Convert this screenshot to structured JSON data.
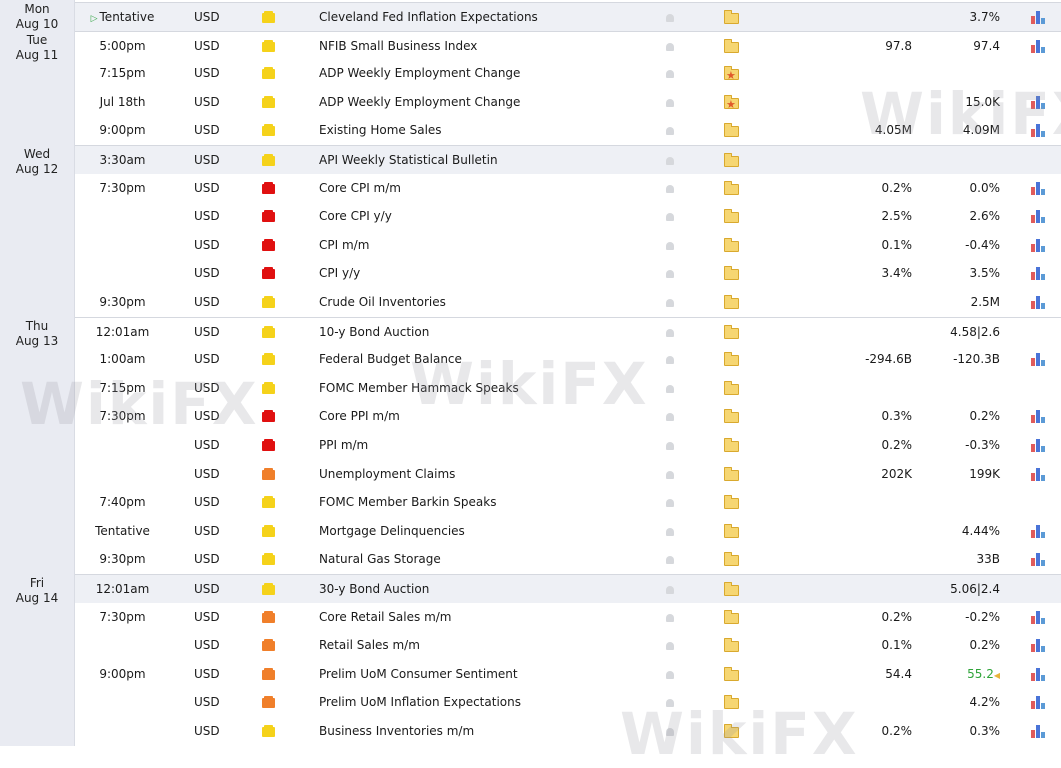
{
  "days": [
    {
      "weekday": "Mon",
      "date": "Aug 10"
    },
    {
      "weekday": "Tue",
      "date": "Aug 11"
    },
    {
      "weekday": "Wed",
      "date": "Aug 12"
    },
    {
      "weekday": "Thu",
      "date": "Aug 13"
    },
    {
      "weekday": "Fri",
      "date": "Aug 14"
    }
  ],
  "rows": [
    {
      "time": "Tentative",
      "tentative_marker": true,
      "currency": "USD",
      "importance": "low",
      "event": "Cleveland Fed Inflation Expectations",
      "actual": "",
      "forecast": "",
      "previous": "3.7%",
      "chart": true,
      "day_start": true,
      "folder": "plain"
    },
    {
      "time": "5:00pm",
      "currency": "USD",
      "importance": "low",
      "event": "NFIB Small Business Index",
      "actual": "97.8",
      "forecast": "",
      "previous": "97.4",
      "chart": true,
      "day_start": true,
      "folder": "plain"
    },
    {
      "time": "7:15pm",
      "currency": "USD",
      "importance": "low",
      "event": "ADP Weekly Employment Change",
      "actual": "",
      "forecast": "",
      "previous": "",
      "chart": false,
      "folder": "star"
    },
    {
      "time": "Jul 18th",
      "currency": "USD",
      "importance": "low",
      "event": "ADP Weekly Employment Change",
      "actual": "",
      "forecast": "",
      "previous": "15.0K",
      "chart": true,
      "folder": "star"
    },
    {
      "time": "9:00pm",
      "currency": "USD",
      "importance": "low",
      "event": "Existing Home Sales",
      "actual": "4.05M",
      "forecast": "",
      "previous": "4.09M",
      "chart": true,
      "folder": "plain"
    },
    {
      "time": "3:30am",
      "currency": "USD",
      "importance": "low",
      "event": "API Weekly Statistical Bulletin",
      "actual": "",
      "forecast": "",
      "previous": "",
      "chart": false,
      "day_start": true,
      "folder": "plain"
    },
    {
      "time": "7:30pm",
      "currency": "USD",
      "importance": "high",
      "event": "Core CPI m/m",
      "actual": "0.2%",
      "forecast": "",
      "previous": "0.0%",
      "chart": true,
      "folder": "plain"
    },
    {
      "time": "",
      "currency": "USD",
      "importance": "high",
      "event": "Core CPI y/y",
      "actual": "2.5%",
      "forecast": "",
      "previous": "2.6%",
      "chart": true,
      "folder": "plain"
    },
    {
      "time": "",
      "currency": "USD",
      "importance": "high",
      "event": "CPI m/m",
      "actual": "0.1%",
      "forecast": "",
      "previous": "-0.4%",
      "chart": true,
      "folder": "plain"
    },
    {
      "time": "",
      "currency": "USD",
      "importance": "high",
      "event": "CPI y/y",
      "actual": "3.4%",
      "forecast": "",
      "previous": "3.5%",
      "chart": true,
      "folder": "plain"
    },
    {
      "time": "9:30pm",
      "currency": "USD",
      "importance": "low",
      "event": "Crude Oil Inventories",
      "actual": "",
      "forecast": "",
      "previous": "2.5M",
      "chart": true,
      "folder": "plain"
    },
    {
      "time": "12:01am",
      "currency": "USD",
      "importance": "low",
      "event": "10-y Bond Auction",
      "actual": "",
      "forecast": "",
      "previous": "4.58|2.6",
      "chart": false,
      "day_start": true,
      "folder": "plain"
    },
    {
      "time": "1:00am",
      "currency": "USD",
      "importance": "low",
      "event": "Federal Budget Balance",
      "actual": "-294.6B",
      "forecast": "",
      "previous": "-120.3B",
      "chart": true,
      "folder": "plain"
    },
    {
      "time": "7:15pm",
      "currency": "USD",
      "importance": "low",
      "event": "FOMC Member Hammack Speaks",
      "actual": "",
      "forecast": "",
      "previous": "",
      "chart": false,
      "folder": "plain"
    },
    {
      "time": "7:30pm",
      "currency": "USD",
      "importance": "high",
      "event": "Core PPI m/m",
      "actual": "0.3%",
      "forecast": "",
      "previous": "0.2%",
      "chart": true,
      "folder": "plain"
    },
    {
      "time": "",
      "currency": "USD",
      "importance": "high",
      "event": "PPI m/m",
      "actual": "0.2%",
      "forecast": "",
      "previous": "-0.3%",
      "chart": true,
      "folder": "plain"
    },
    {
      "time": "",
      "currency": "USD",
      "importance": "medium",
      "event": "Unemployment Claims",
      "actual": "202K",
      "forecast": "",
      "previous": "199K",
      "chart": true,
      "folder": "plain"
    },
    {
      "time": "7:40pm",
      "currency": "USD",
      "importance": "low",
      "event": "FOMC Member Barkin Speaks",
      "actual": "",
      "forecast": "",
      "previous": "",
      "chart": false,
      "folder": "plain"
    },
    {
      "time": "Tentative",
      "currency": "USD",
      "importance": "low",
      "event": "Mortgage Delinquencies",
      "actual": "",
      "forecast": "",
      "previous": "4.44%",
      "chart": true,
      "folder": "plain"
    },
    {
      "time": "9:30pm",
      "currency": "USD",
      "importance": "low",
      "event": "Natural Gas Storage",
      "actual": "",
      "forecast": "",
      "previous": "33B",
      "chart": true,
      "folder": "plain"
    },
    {
      "time": "12:01am",
      "currency": "USD",
      "importance": "low",
      "event": "30-y Bond Auction",
      "actual": "",
      "forecast": "",
      "previous": "5.06|2.4",
      "chart": false,
      "day_start": true,
      "folder": "plain"
    },
    {
      "time": "7:30pm",
      "currency": "USD",
      "importance": "medium",
      "event": "Core Retail Sales m/m",
      "actual": "0.2%",
      "forecast": "",
      "previous": "-0.2%",
      "chart": true,
      "folder": "plain"
    },
    {
      "time": "",
      "currency": "USD",
      "importance": "medium",
      "event": "Retail Sales m/m",
      "actual": "0.1%",
      "forecast": "",
      "previous": "0.2%",
      "chart": true,
      "folder": "plain"
    },
    {
      "time": "9:00pm",
      "currency": "USD",
      "importance": "medium",
      "event": "Prelim UoM Consumer Sentiment",
      "actual": "54.4",
      "forecast": "",
      "previous": "55.2",
      "previous_revised": true,
      "chart": true,
      "folder": "plain"
    },
    {
      "time": "",
      "currency": "USD",
      "importance": "medium",
      "event": "Prelim UoM Inflation Expectations",
      "actual": "",
      "forecast": "",
      "previous": "4.2%",
      "chart": true,
      "folder": "plain"
    },
    {
      "time": "",
      "currency": "USD",
      "importance": "low",
      "event": "Business Inventories m/m",
      "actual": "0.2%",
      "forecast": "",
      "previous": "0.3%",
      "chart": true,
      "folder": "plain"
    }
  ],
  "colors": {
    "importance_high": "#e01010",
    "importance_medium": "#f07f2a",
    "importance_low": "#f5d21a"
  },
  "icons": {
    "bell": "bell-icon",
    "folder": "folder-icon",
    "chart": "chart-icon",
    "tentative": "play-icon",
    "watermark": "wikifx-watermark"
  },
  "watermark_text": "WikiFX"
}
